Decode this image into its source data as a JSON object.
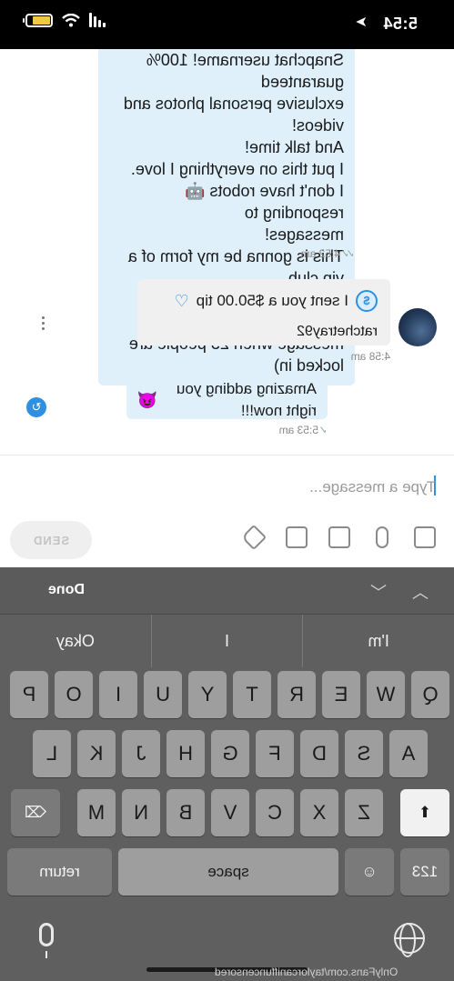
{
  "status_bar": {
    "time": "5:54",
    "location_arrow": "➤",
    "battery_level": 0.78
  },
  "messages": [
    {
      "direction": "incoming",
      "text": "Snapchat username! 100% guaranteed\nexclusive personal photos and videos!\nAnd talk time!\nI put this on everything I love.\nI don't have robots 🤖 responding to\nmessages!\nThis is gonna be my form of a vip club.\nOnly doing 25 people (will unsend this\nmessage when 25 people are locked in)",
      "time": "4:52 am"
    },
    {
      "direction": "outgoing",
      "tip_text": "I sent you a $50.00 tip",
      "username": "ratchetray92",
      "time": "4:58 am"
    },
    {
      "direction": "incoming",
      "text": "Amazing adding you right now!!!",
      "emoji": "😈",
      "time": "5:53 am"
    }
  ],
  "composer": {
    "placeholder": "Type a message...",
    "send_label": "SEND",
    "tools": [
      "image-icon",
      "mic-icon",
      "media-vault-icon",
      "schedule-icon",
      "price-tag-icon"
    ]
  },
  "keyboard": {
    "done_label": "Done",
    "suggestions": [
      "I'm",
      "I",
      "Okay"
    ],
    "row1": [
      "Q",
      "W",
      "E",
      "R",
      "T",
      "Y",
      "U",
      "I",
      "O",
      "P"
    ],
    "row2": [
      "A",
      "S",
      "D",
      "F",
      "G",
      "H",
      "J",
      "K",
      "L"
    ],
    "row3": [
      "Z",
      "X",
      "C",
      "V",
      "B",
      "N",
      "M"
    ],
    "numbers_label": "123",
    "space_label": "space",
    "return_label": "return"
  },
  "watermark": "OnlyFans.com/taylorcaniffuncensored"
}
